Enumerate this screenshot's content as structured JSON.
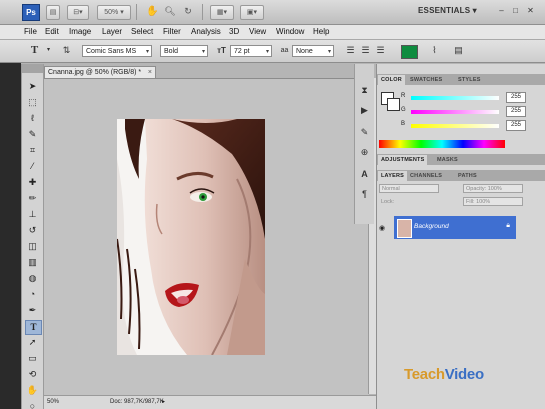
{
  "app": {
    "logo": "Ps"
  },
  "appbar": {
    "zoom": "50%",
    "workspace": "ESSENTIALS",
    "workspace_arrow": "▾",
    "minimize": "–",
    "maximize": "□",
    "close": "✕"
  },
  "menu": [
    "File",
    "Edit",
    "Image",
    "Layer",
    "Select",
    "Filter",
    "Analysis",
    "3D",
    "View",
    "Window",
    "Help"
  ],
  "options": {
    "tool_glyph": "T",
    "font_family": "Comic Sans MS",
    "font_style": "Bold",
    "font_size": "72 pt",
    "antialias": "None",
    "color_hex": "#0e8c3f"
  },
  "document": {
    "tab_title": "Cnanna.jpg @ 50% (RGB/8) *",
    "tab_close": "×",
    "zoom": "50%",
    "doc_info": "Doc: 987,7K/987,7K"
  },
  "panels": {
    "color_tabs": [
      "COLOR",
      "SWATCHES",
      "STYLES"
    ],
    "channels": [
      {
        "label": "R",
        "value": "255"
      },
      {
        "label": "G",
        "value": "255"
      },
      {
        "label": "B",
        "value": "255"
      }
    ],
    "adjust_tabs": [
      "ADJUSTMENTS",
      "MASKS"
    ],
    "layer_tabs": [
      "LAYERS",
      "CHANNELS",
      "PATHS"
    ],
    "blend_mode": "Normal",
    "opacity_label": "Opacity: 100%",
    "lock_label": "Lock:",
    "fill_label": "Fill: 100%",
    "layer_name": "Background"
  },
  "watermark": {
    "part1": "Teach",
    "part2": "Video"
  },
  "colors": {
    "accent": "#3f6fd1",
    "text_color": "#0e8c3f",
    "ps_blue": "#2b5fb8"
  }
}
